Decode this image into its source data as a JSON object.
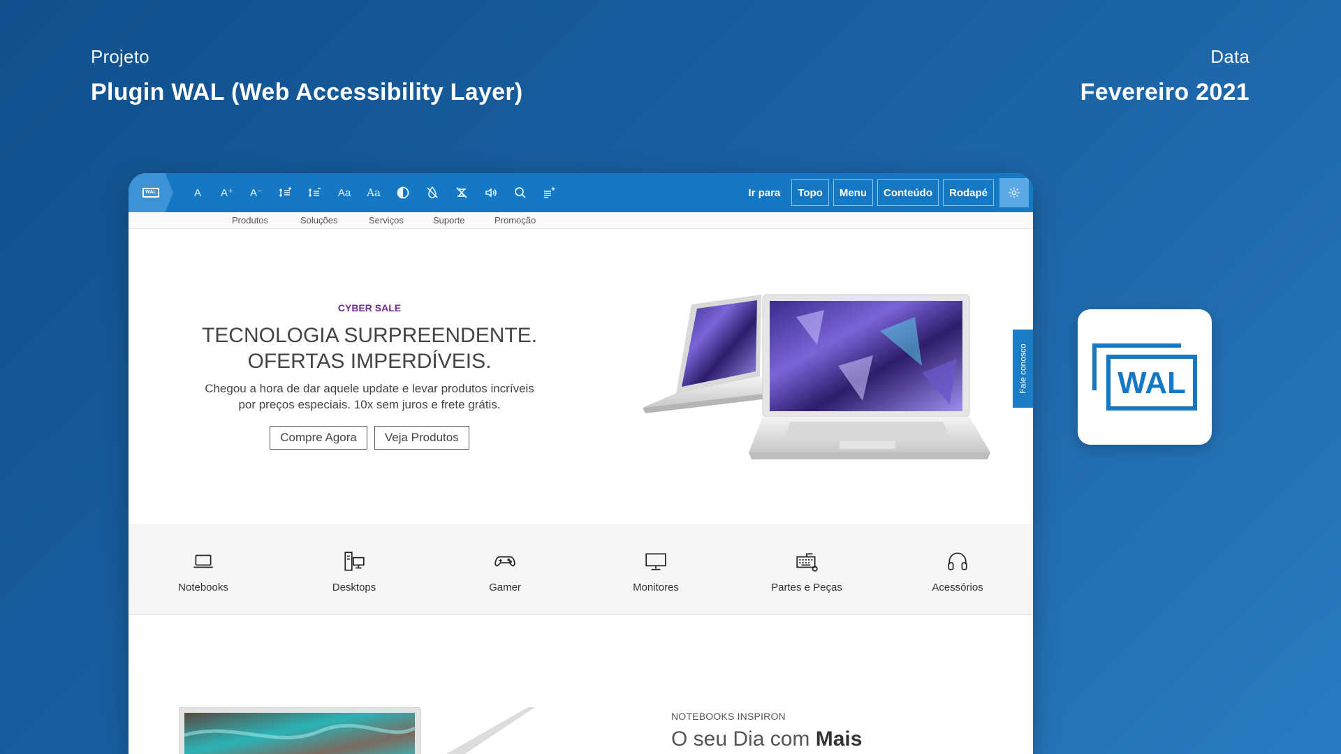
{
  "header": {
    "project_label": "Projeto",
    "project_title": "Plugin WAL (Web Accessibility Layer)",
    "date_label": "Data",
    "date_value": "Fevereiro 2021"
  },
  "toolbar": {
    "badge_text": "WAL",
    "tools": [
      {
        "icon": "font-reset-icon",
        "text": "A"
      },
      {
        "icon": "font-increase-icon",
        "text": "A⁺"
      },
      {
        "icon": "font-decrease-icon",
        "text": "A⁻"
      },
      {
        "icon": "line-height-increase-icon",
        "text": ""
      },
      {
        "icon": "line-height-decrease-icon",
        "text": ""
      },
      {
        "icon": "font-family-icon",
        "text": "Aa"
      },
      {
        "icon": "letter-spacing-icon",
        "text": "Aa"
      },
      {
        "icon": "contrast-icon",
        "text": ""
      },
      {
        "icon": "grayscale-icon",
        "text": ""
      },
      {
        "icon": "disable-animations-icon",
        "text": ""
      },
      {
        "icon": "audio-icon",
        "text": ""
      },
      {
        "icon": "search-icon",
        "text": ""
      },
      {
        "icon": "reading-guide-icon",
        "text": ""
      }
    ],
    "skip_label": "Ir para",
    "skip_links": [
      "Topo",
      "Menu",
      "Conteúdo",
      "Rodapé"
    ],
    "settings_icon": "gear-icon"
  },
  "site_nav": [
    "Produtos",
    "Soluções",
    "Serviços",
    "Suporte",
    "Promoção"
  ],
  "hero": {
    "kicker": "CYBER SALE",
    "title_line1": "TECNOLOGIA SURPREENDENTE.",
    "title_line2": "OFERTAS IMPERDÍVEIS.",
    "desc_line1": "Chegou a hora de dar aquele update e levar produtos incríveis",
    "desc_line2": "por preços especiais. 10x sem juros e frete grátis.",
    "btn_primary": "Compre Agora",
    "btn_secondary": "Veja Produtos"
  },
  "side_tab": "Fale conosco",
  "categories": [
    {
      "icon": "laptop-icon",
      "label": "Notebooks"
    },
    {
      "icon": "desktop-icon",
      "label": "Desktops"
    },
    {
      "icon": "gamepad-icon",
      "label": "Gamer"
    },
    {
      "icon": "monitor-icon",
      "label": "Monitores"
    },
    {
      "icon": "keyboard-icon",
      "label": "Partes e Peças"
    },
    {
      "icon": "headphones-icon",
      "label": "Acessórios"
    }
  ],
  "section": {
    "kicker": "NOTEBOOKS INSPIRON",
    "title_light": "O seu Dia com ",
    "title_bold": "Mais"
  },
  "logo_card": {
    "text": "WAL"
  },
  "colors": {
    "background": "#1a5fa0",
    "toolbar": "#1478c4",
    "accent_purple": "#6d2d8f",
    "logo_blue": "#1478c4"
  }
}
